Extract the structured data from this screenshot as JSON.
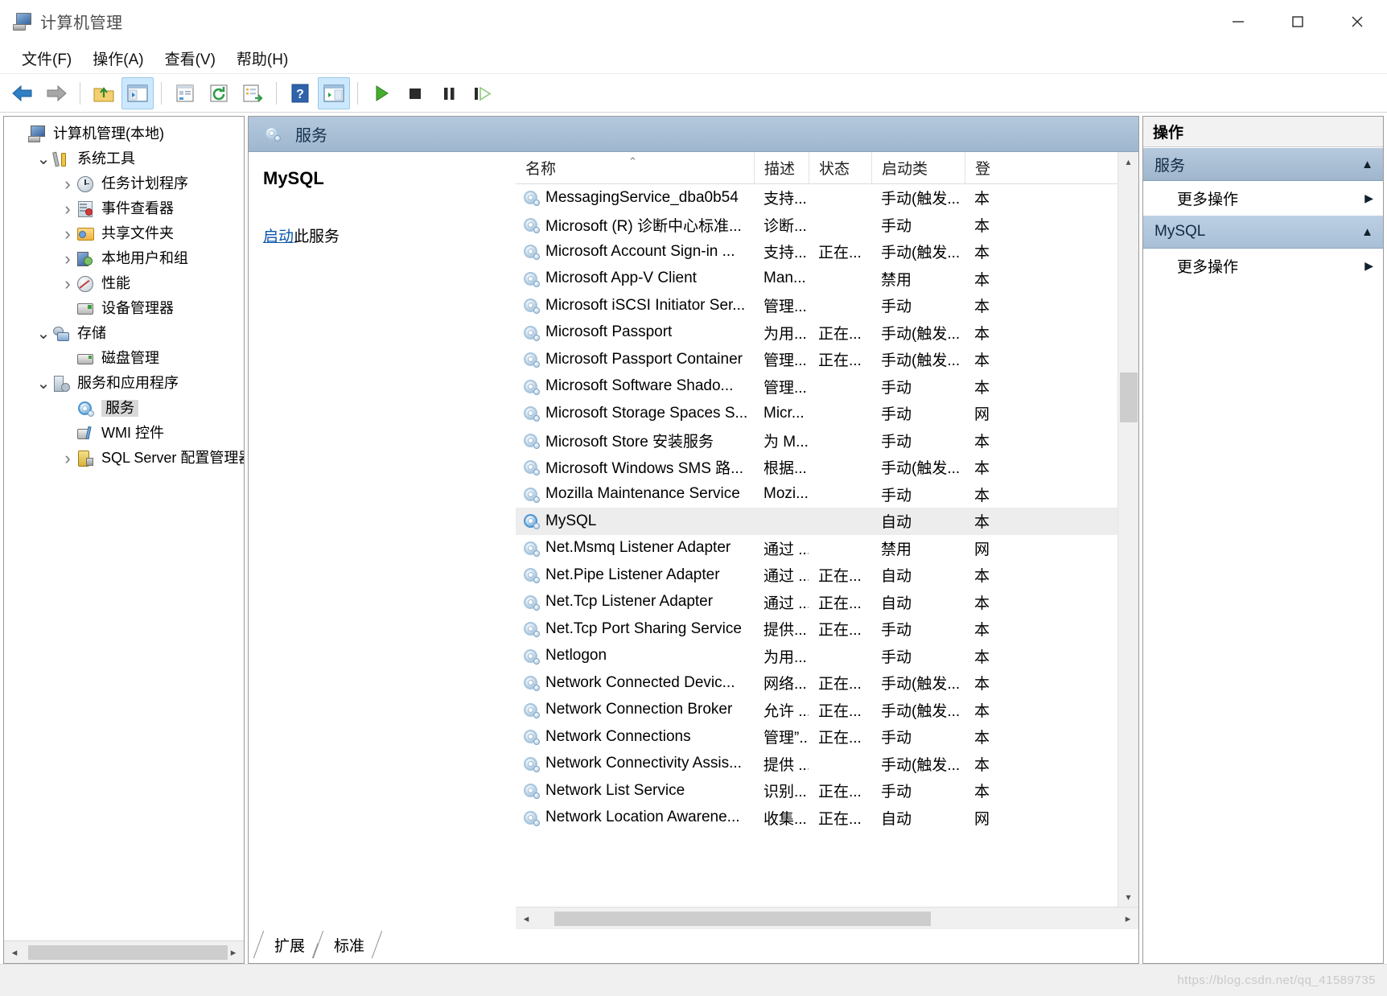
{
  "window": {
    "title": "计算机管理",
    "icon": "computer-management-icon",
    "minimize_label": "最小化",
    "maximize_label": "最大化",
    "close_label": "关闭"
  },
  "menu": {
    "items": [
      {
        "label": "文件(F)",
        "name": "menu-file"
      },
      {
        "label": "操作(A)",
        "name": "menu-action"
      },
      {
        "label": "查看(V)",
        "name": "menu-view"
      },
      {
        "label": "帮助(H)",
        "name": "menu-help"
      }
    ]
  },
  "toolbar": {
    "buttons": [
      {
        "name": "back-button",
        "icon": "back-arrow-icon",
        "active": false
      },
      {
        "name": "forward-button",
        "icon": "forward-arrow-icon",
        "active": false
      },
      {
        "name": "up-folder-button",
        "icon": "up-folder-icon",
        "active": false
      },
      {
        "name": "show-hide-tree-button",
        "icon": "show-hide-console-tree-icon",
        "active": true
      },
      {
        "name": "properties-button",
        "icon": "properties-icon",
        "active": false
      },
      {
        "name": "refresh-button",
        "icon": "refresh-icon",
        "active": false
      },
      {
        "name": "export-list-button",
        "icon": "export-list-icon",
        "active": false
      },
      {
        "name": "help-button",
        "icon": "help-icon",
        "active": false
      },
      {
        "name": "show-action-pane-button",
        "icon": "show-action-pane-icon",
        "active": true
      },
      {
        "name": "start-service-button",
        "icon": "play-icon",
        "active": false
      },
      {
        "name": "stop-service-button",
        "icon": "stop-icon",
        "active": false
      },
      {
        "name": "pause-service-button",
        "icon": "pause-icon",
        "active": false
      },
      {
        "name": "restart-service-button",
        "icon": "restart-icon",
        "active": false
      }
    ]
  },
  "tree": {
    "nodes": [
      {
        "label": "计算机管理(本地)",
        "indent": 0,
        "twisty": "none",
        "icon": "computer-icon",
        "name": "tree-node-computer-management",
        "selected": false
      },
      {
        "label": "系统工具",
        "indent": 1,
        "twisty": "expanded",
        "icon": "system-tools-icon",
        "name": "tree-node-system-tools",
        "selected": false
      },
      {
        "label": "任务计划程序",
        "indent": 2,
        "twisty": "collapsed",
        "icon": "task-scheduler-icon",
        "name": "tree-node-task-scheduler",
        "selected": false
      },
      {
        "label": "事件查看器",
        "indent": 2,
        "twisty": "collapsed",
        "icon": "event-viewer-icon",
        "name": "tree-node-event-viewer",
        "selected": false
      },
      {
        "label": "共享文件夹",
        "indent": 2,
        "twisty": "collapsed",
        "icon": "shared-folders-icon",
        "name": "tree-node-shared-folders",
        "selected": false
      },
      {
        "label": "本地用户和组",
        "indent": 2,
        "twisty": "collapsed",
        "icon": "local-users-groups-icon",
        "name": "tree-node-local-users-groups",
        "selected": false
      },
      {
        "label": "性能",
        "indent": 2,
        "twisty": "collapsed",
        "icon": "performance-icon",
        "name": "tree-node-performance",
        "selected": false
      },
      {
        "label": "设备管理器",
        "indent": 2,
        "twisty": "none",
        "icon": "device-manager-icon",
        "name": "tree-node-device-manager",
        "selected": false
      },
      {
        "label": "存储",
        "indent": 1,
        "twisty": "expanded",
        "icon": "storage-icon",
        "name": "tree-node-storage",
        "selected": false
      },
      {
        "label": "磁盘管理",
        "indent": 2,
        "twisty": "none",
        "icon": "disk-management-icon",
        "name": "tree-node-disk-management",
        "selected": false
      },
      {
        "label": "服务和应用程序",
        "indent": 1,
        "twisty": "expanded",
        "icon": "services-apps-icon",
        "name": "tree-node-services-and-apps",
        "selected": false
      },
      {
        "label": "服务",
        "indent": 2,
        "twisty": "none",
        "icon": "services-gear-icon",
        "name": "tree-node-services",
        "selected": true
      },
      {
        "label": "WMI 控件",
        "indent": 2,
        "twisty": "none",
        "icon": "wmi-control-icon",
        "name": "tree-node-wmi-control",
        "selected": false
      },
      {
        "label": "SQL Server 配置管理器",
        "indent": 2,
        "twisty": "collapsed",
        "icon": "sql-server-icon",
        "name": "tree-node-sql-server-config",
        "selected": false
      }
    ]
  },
  "services_panel": {
    "header_title": "服务",
    "header_icon": "services-gear-icon",
    "detail": {
      "service_name": "MySQL",
      "action_link": "启动",
      "action_suffix": "此服务"
    },
    "columns": [
      {
        "key": "name",
        "label": "名称",
        "sorted": true
      },
      {
        "key": "desc",
        "label": "描述",
        "sorted": false
      },
      {
        "key": "state",
        "label": "状态",
        "sorted": false
      },
      {
        "key": "start",
        "label": "启动类",
        "sorted": false
      },
      {
        "key": "logon",
        "label": "登",
        "sorted": false
      }
    ],
    "rows": [
      {
        "name": "MessagingService_dba0b54",
        "desc": "支持...",
        "state": "",
        "start": "手动(触发...",
        "logon": "本",
        "selected": false
      },
      {
        "name": "Microsoft (R) 诊断中心标准...",
        "desc": "诊断...",
        "state": "",
        "start": "手动",
        "logon": "本",
        "selected": false
      },
      {
        "name": "Microsoft Account Sign-in ...",
        "desc": "支持...",
        "state": "正在...",
        "start": "手动(触发...",
        "logon": "本",
        "selected": false
      },
      {
        "name": "Microsoft App-V Client",
        "desc": "Man...",
        "state": "",
        "start": "禁用",
        "logon": "本",
        "selected": false
      },
      {
        "name": "Microsoft iSCSI Initiator Ser...",
        "desc": "管理...",
        "state": "",
        "start": "手动",
        "logon": "本",
        "selected": false
      },
      {
        "name": "Microsoft Passport",
        "desc": "为用...",
        "state": "正在...",
        "start": "手动(触发...",
        "logon": "本",
        "selected": false
      },
      {
        "name": "Microsoft Passport Container",
        "desc": "管理...",
        "state": "正在...",
        "start": "手动(触发...",
        "logon": "本",
        "selected": false
      },
      {
        "name": "Microsoft Software Shado...",
        "desc": "管理...",
        "state": "",
        "start": "手动",
        "logon": "本",
        "selected": false
      },
      {
        "name": "Microsoft Storage Spaces S...",
        "desc": "Micr...",
        "state": "",
        "start": "手动",
        "logon": "网",
        "selected": false
      },
      {
        "name": "Microsoft Store 安装服务",
        "desc": "为 M...",
        "state": "",
        "start": "手动",
        "logon": "本",
        "selected": false
      },
      {
        "name": "Microsoft Windows SMS 路...",
        "desc": "根据...",
        "state": "",
        "start": "手动(触发...",
        "logon": "本",
        "selected": false
      },
      {
        "name": "Mozilla Maintenance Service",
        "desc": "Mozi...",
        "state": "",
        "start": "手动",
        "logon": "本",
        "selected": false
      },
      {
        "name": "MySQL",
        "desc": "",
        "state": "",
        "start": "自动",
        "logon": "本",
        "selected": true
      },
      {
        "name": "Net.Msmq Listener Adapter",
        "desc": "通过 ...",
        "state": "",
        "start": "禁用",
        "logon": "网",
        "selected": false
      },
      {
        "name": "Net.Pipe Listener Adapter",
        "desc": "通过 ...",
        "state": "正在...",
        "start": "自动",
        "logon": "本",
        "selected": false
      },
      {
        "name": "Net.Tcp Listener Adapter",
        "desc": "通过 ...",
        "state": "正在...",
        "start": "自动",
        "logon": "本",
        "selected": false
      },
      {
        "name": "Net.Tcp Port Sharing Service",
        "desc": "提供...",
        "state": "正在...",
        "start": "手动",
        "logon": "本",
        "selected": false
      },
      {
        "name": "Netlogon",
        "desc": "为用...",
        "state": "",
        "start": "手动",
        "logon": "本",
        "selected": false
      },
      {
        "name": "Network Connected Devic...",
        "desc": "网络...",
        "state": "正在...",
        "start": "手动(触发...",
        "logon": "本",
        "selected": false
      },
      {
        "name": "Network Connection Broker",
        "desc": "允许 ...",
        "state": "正在...",
        "start": "手动(触发...",
        "logon": "本",
        "selected": false
      },
      {
        "name": "Network Connections",
        "desc": "管理”...",
        "state": "正在...",
        "start": "手动",
        "logon": "本",
        "selected": false
      },
      {
        "name": "Network Connectivity Assis...",
        "desc": "提供 ...",
        "state": "",
        "start": "手动(触发...",
        "logon": "本",
        "selected": false
      },
      {
        "name": "Network List Service",
        "desc": "识别...",
        "state": "正在...",
        "start": "手动",
        "logon": "本",
        "selected": false
      },
      {
        "name": "Network Location Awarene...",
        "desc": "收集...",
        "state": "正在...",
        "start": "自动",
        "logon": "网",
        "selected": false
      }
    ],
    "tabs": [
      {
        "label": "扩展",
        "name": "tab-extended",
        "active": false
      },
      {
        "label": "标准",
        "name": "tab-standard",
        "active": true
      }
    ]
  },
  "actions_panel": {
    "title": "操作",
    "groups": [
      {
        "header": "服务",
        "name": "action-group-services",
        "items": [
          {
            "label": "更多操作",
            "name": "action-more-actions-services"
          }
        ]
      },
      {
        "header": "MySQL",
        "name": "action-group-mysql",
        "items": [
          {
            "label": "更多操作",
            "name": "action-more-actions-mysql"
          }
        ]
      }
    ]
  },
  "statusbar": {
    "watermark": "https://blog.csdn.net/qq_41589735"
  },
  "colors": {
    "header_blue": "#a7bdd3",
    "selection_gray": "#ededed",
    "link_blue": "#0b55a8",
    "toolbar_active": "#cce8ff"
  }
}
